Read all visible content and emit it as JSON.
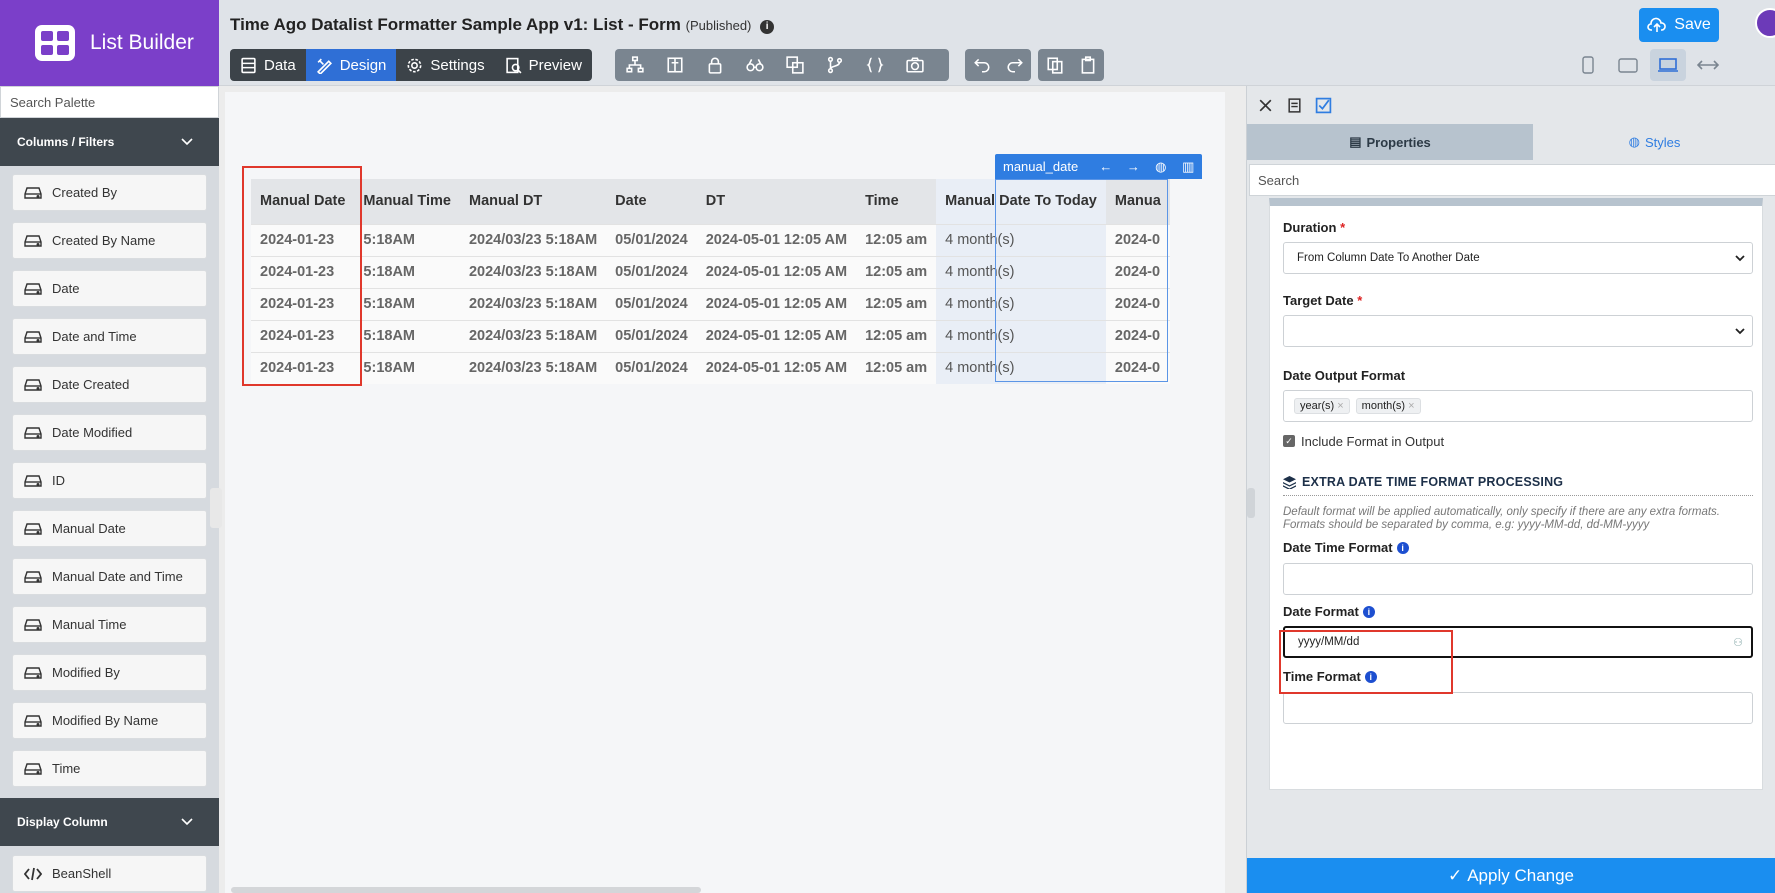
{
  "brand": {
    "name": "List Builder"
  },
  "header": {
    "title": "Time Ago Datalist Formatter Sample App v1: List - Form",
    "status": "(Published)",
    "save_label": "Save"
  },
  "tabs": [
    {
      "label": "Data"
    },
    {
      "label": "Design"
    },
    {
      "label": "Settings"
    },
    {
      "label": "Preview"
    }
  ],
  "palette": {
    "search_placeholder": "Search Palette",
    "section1": "Columns / Filters",
    "items": [
      "Created By",
      "Created By Name",
      "Date",
      "Date and Time",
      "Date Created",
      "Date Modified",
      "ID",
      "Manual Date",
      "Manual Date and Time",
      "Manual Time",
      "Modified By",
      "Modified By Name",
      "Time"
    ],
    "section2": "Display Column",
    "items2": [
      "BeanShell"
    ]
  },
  "canvas": {
    "selected_label": "manual_date",
    "columns": [
      "Manual Date",
      "Manual Time",
      "Manual DT",
      "Date",
      "DT",
      "Time",
      "Manual Date To Today",
      "Manua"
    ],
    "rows": [
      [
        "2024-01-23",
        "5:18AM",
        "2024/03/23 5:18AM",
        "05/01/2024",
        "2024-05-01 12:05 AM",
        "12:05 am",
        "4 month(s)",
        "2024-0"
      ],
      [
        "2024-01-23",
        "5:18AM",
        "2024/03/23 5:18AM",
        "05/01/2024",
        "2024-05-01 12:05 AM",
        "12:05 am",
        "4 month(s)",
        "2024-0"
      ],
      [
        "2024-01-23",
        "5:18AM",
        "2024/03/23 5:18AM",
        "05/01/2024",
        "2024-05-01 12:05 AM",
        "12:05 am",
        "4 month(s)",
        "2024-0"
      ],
      [
        "2024-01-23",
        "5:18AM",
        "2024/03/23 5:18AM",
        "05/01/2024",
        "2024-05-01 12:05 AM",
        "12:05 am",
        "4 month(s)",
        "2024-0"
      ],
      [
        "2024-01-23",
        "5:18AM",
        "2024/03/23 5:18AM",
        "05/01/2024",
        "2024-05-01 12:05 AM",
        "12:05 am",
        "4 month(s)",
        "2024-0"
      ]
    ]
  },
  "properties": {
    "tab_properties": "Properties",
    "tab_styles": "Styles",
    "search_placeholder": "Search",
    "duration_label": "Duration",
    "duration_value": "From Column Date To Another Date",
    "target_label": "Target Date",
    "target_value": "",
    "output_format_label": "Date Output Format",
    "output_tags": [
      "year(s)",
      "month(s)"
    ],
    "include_label": "Include Format in Output",
    "section_title": "EXTRA DATE TIME FORMAT PROCESSING",
    "section_note": "Default format will be applied automatically, only specify if there are any extra formats. Formats should be separated by comma, e.g: yyyy-MM-dd, dd-MM-yyyy",
    "dt_format_label": "Date Time Format",
    "dt_format_value": "",
    "date_format_label": "Date Format",
    "date_format_value": "yyyy/MM/dd",
    "time_format_label": "Time Format",
    "time_format_value": "",
    "apply_label": "Apply Change"
  },
  "colors": {
    "brand": "#7b3fc9",
    "accent": "#2f7de1",
    "save": "#1a8ef0",
    "highlight": "#e0382c"
  }
}
